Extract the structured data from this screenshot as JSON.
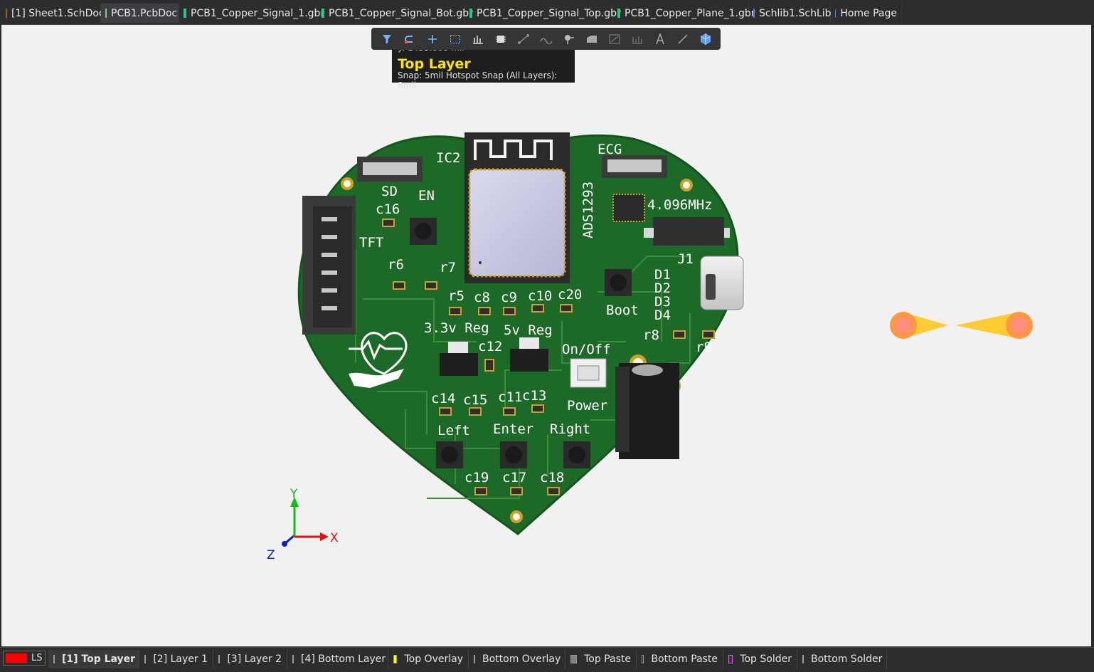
{
  "tabs": [
    {
      "label": "[1] Sheet1.SchDoc",
      "icon": "schematic-doc-icon"
    },
    {
      "label": "PCB1.PcbDoc",
      "icon": "pcb-doc-icon",
      "active": true
    },
    {
      "label": "PCB1_Copper_Signal_1.gbr",
      "icon": "gerber-file-icon"
    },
    {
      "label": "PCB1_Copper_Signal_Bot.gbr",
      "icon": "gerber-file-icon"
    },
    {
      "label": "PCB1_Copper_Signal_Top.gbr",
      "icon": "gerber-file-icon"
    },
    {
      "label": "PCB1_Copper_Plane_1.gbr",
      "icon": "gerber-file-icon"
    },
    {
      "label": "Schlib1.SchLib",
      "icon": "schematic-library-icon"
    },
    {
      "label": "Home Page",
      "icon": "home-icon"
    }
  ],
  "toolbar": {
    "icons": [
      "filter-icon",
      "route-icon",
      "crosshair-icon",
      "select-rect-icon",
      "align-icon",
      "component-icon",
      "connection-icon",
      "interactive-route-icon",
      "pin-icon",
      "polygon-icon",
      "dimension-icon",
      "region-icon",
      "text-icon",
      "line-icon",
      "3d-body-icon"
    ]
  },
  "hud": {
    "coord": "y:  1435.000 mil",
    "layer": "Top Layer",
    "snap": "Snap: 5mil Hotspot Snap (All Layers): 8mil"
  },
  "board": {
    "labels": {
      "ic2": "IC2",
      "sd": "SD",
      "en": "EN",
      "c16": "c16",
      "tft": "TFT",
      "r6": "r6",
      "r7": "r7",
      "ecg": "ECG",
      "ads": "ADS1293",
      "freq": "4.096MHz",
      "j1": "J1",
      "d1": "D1",
      "d2": "D2",
      "d3": "D3",
      "d4": "D4",
      "boot": "Boot",
      "r5": "r5",
      "c8": "c8",
      "c9": "c9",
      "c10": "c10",
      "c20": "c20",
      "reg33": "3.3v Reg",
      "reg5": "5v Reg",
      "c12": "c12",
      "onoff": "On/Off",
      "r8": "r8",
      "r9": "r9",
      "c14": "c14",
      "c15": "c15",
      "c11": "c11",
      "c13": "c13",
      "power": "Power",
      "left": "Left",
      "enter": "Enter",
      "right": "Right",
      "c19": "c19",
      "c17": "c17",
      "c18": "c18"
    },
    "colors": {
      "board": "#1e6b2a",
      "trace": "#3f8a3c",
      "silk": "#ffffff",
      "pad": "#c9a227"
    }
  },
  "axis": {
    "x": "X",
    "y": "Y",
    "z": "Z"
  },
  "layers": {
    "ls_label": "LS",
    "items": [
      {
        "label": "[1] Top Layer",
        "color": "#ff0000",
        "active": true
      },
      {
        "label": "[2] Layer 1",
        "color": "#b8860b"
      },
      {
        "label": "[3] Layer 2",
        "color": "#228b22"
      },
      {
        "label": "[4] Bottom Layer",
        "color": "#0000ff"
      },
      {
        "label": "Top Overlay",
        "color": "#ffff00"
      },
      {
        "label": "Bottom Overlay",
        "color": "#808000"
      },
      {
        "label": "Top Paste",
        "color": "#808080"
      },
      {
        "label": "Bottom Paste",
        "color": "#800000"
      },
      {
        "label": "Top Solder",
        "color": "#800080"
      },
      {
        "label": "Bottom Solder",
        "color": "#ff00ff"
      }
    ]
  }
}
